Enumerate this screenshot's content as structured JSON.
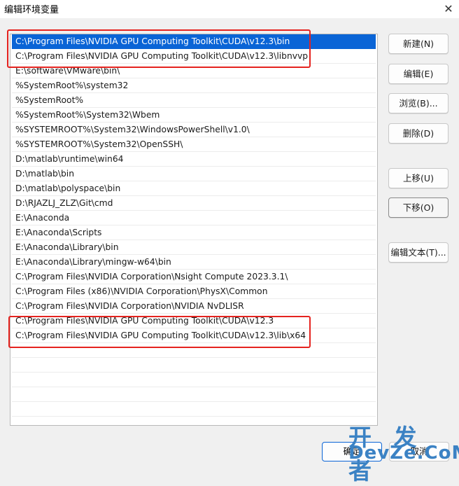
{
  "window": {
    "title": "编辑环境变量",
    "close_glyph": "✕"
  },
  "path_entries": [
    "C:\\Program Files\\NVIDIA GPU Computing Toolkit\\CUDA\\v12.3\\bin",
    "C:\\Program Files\\NVIDIA GPU Computing Toolkit\\CUDA\\v12.3\\libnvvp",
    "E:\\software\\VMware\\bin\\",
    "%SystemRoot%\\system32",
    "%SystemRoot%",
    "%SystemRoot%\\System32\\Wbem",
    "%SYSTEMROOT%\\System32\\WindowsPowerShell\\v1.0\\",
    "%SYSTEMROOT%\\System32\\OpenSSH\\",
    "D:\\matlab\\runtime\\win64",
    "D:\\matlab\\bin",
    "D:\\matlab\\polyspace\\bin",
    "D:\\RJAZLJ_ZLZ\\Git\\cmd",
    "E:\\Anaconda",
    "E:\\Anaconda\\Scripts",
    "E:\\Anaconda\\Library\\bin",
    "E:\\Anaconda\\Library\\mingw-w64\\bin",
    "C:\\Program Files\\NVIDIA Corporation\\Nsight Compute 2023.3.1\\",
    "C:\\Program Files (x86)\\NVIDIA Corporation\\PhysX\\Common",
    "C:\\Program Files\\NVIDIA Corporation\\NVIDIA NvDLISR",
    "C:\\Program Files\\NVIDIA GPU Computing Toolkit\\CUDA\\v12.3",
    "C:\\Program Files\\NVIDIA GPU Computing Toolkit\\CUDA\\v12.3\\lib\\x64"
  ],
  "selected_index": 0,
  "buttons": {
    "new": "新建(N)",
    "edit": "编辑(E)",
    "browse": "浏览(B)...",
    "delete": "删除(D)",
    "move_up": "上移(U)",
    "move_down": "下移(O)",
    "edit_text": "编辑文本(T)...",
    "ok": "确定",
    "cancel": "取消"
  },
  "colors": {
    "selection": "#0a64d6",
    "annotation": "#e5231f",
    "watermark": "#3b82c4"
  },
  "watermark": {
    "logo": "开 发 者",
    "site": "DevZe.CoM"
  }
}
